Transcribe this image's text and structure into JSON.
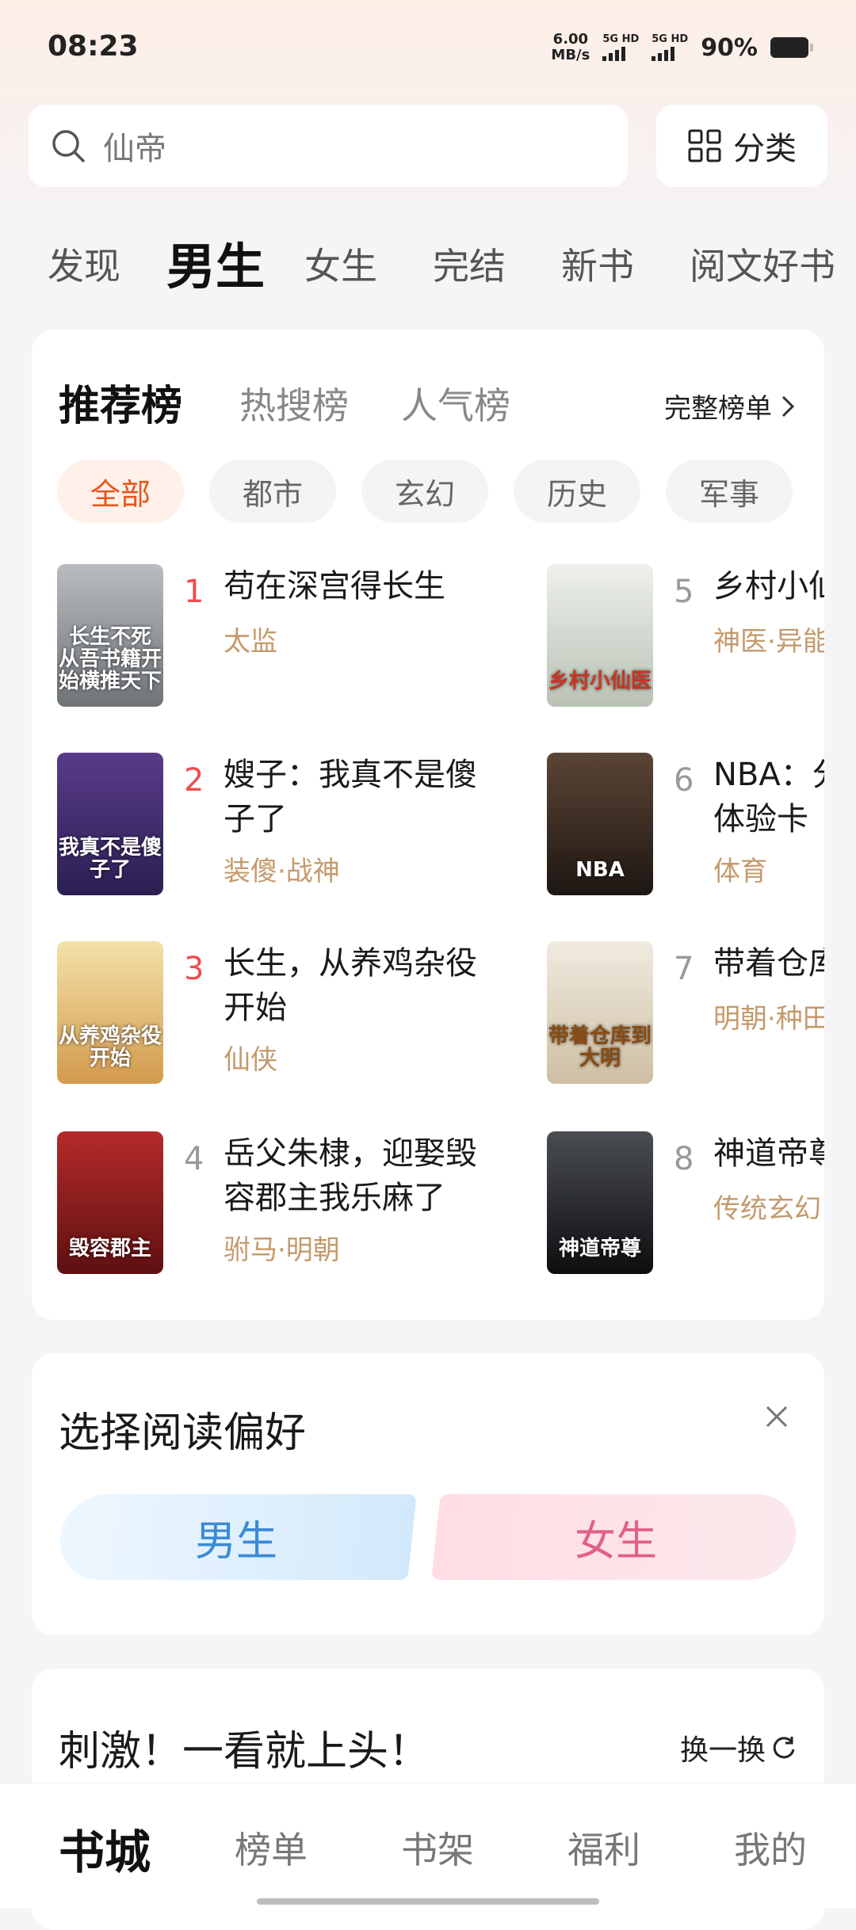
{
  "status": {
    "time": "08:23",
    "net_speed": "6.00",
    "net_unit": "MB/s",
    "sim1": "5G HD",
    "sim2": "5G HD",
    "battery": "90%"
  },
  "search": {
    "placeholder": "仙帝"
  },
  "category_button": "分类",
  "top_tabs": [
    "发现",
    "男生",
    "女生",
    "完结",
    "新书",
    "阅文好书"
  ],
  "ranking": {
    "tabs": [
      "推荐榜",
      "热搜榜",
      "人气榜"
    ],
    "full_list": "完整榜单",
    "chips": [
      "全部",
      "都市",
      "玄幻",
      "历史",
      "军事"
    ],
    "books": [
      {
        "rank": "1",
        "title": "苟在深宫得长生",
        "tags": "太监",
        "cover_text": "长生不死 从吾书籍开始横推天下",
        "cover_color": "#8c9096"
      },
      {
        "rank": "2",
        "title": "嫂子：我真不是傻子了",
        "tags": "装傻·战神",
        "cover_text": "我真不是傻子了",
        "cover_color": "#3a2a6b"
      },
      {
        "rank": "3",
        "title": "长生，从养鸡杂役开始",
        "tags": "仙侠",
        "cover_text": "从养鸡杂役开始",
        "cover_color": "#d9a766"
      },
      {
        "rank": "4",
        "title": "岳父朱棣，迎娶毁容郡主我乐麻了",
        "tags": "驸马·明朝",
        "cover_text": "毁容郡主",
        "cover_color": "#8c1e1e"
      },
      {
        "rank": "5",
        "title": "乡村小仙医",
        "tags": "神医·异能",
        "cover_text": "乡村小仙医",
        "cover_color": "#d9ded8"
      },
      {
        "rank": "6",
        "title": "NBA：分体验卡",
        "tags": "体育",
        "cover_text": "NBA",
        "cover_color": "#3b2a22"
      },
      {
        "rank": "7",
        "title": "带着仓库到大明",
        "tags": "明朝·种田",
        "cover_text": "带着仓库到大明",
        "cover_color": "#e7dfcf"
      },
      {
        "rank": "8",
        "title": "神道帝尊",
        "tags": "传统玄幻",
        "cover_text": "神道帝尊",
        "cover_color": "#222426"
      }
    ]
  },
  "preference": {
    "title": "选择阅读偏好",
    "male": "男生",
    "female": "女生"
  },
  "recommend": {
    "title": "刺激！一看就上头！",
    "refresh": "换一换"
  },
  "bottom_nav": [
    "书城",
    "榜单",
    "书架",
    "福利",
    "我的"
  ]
}
